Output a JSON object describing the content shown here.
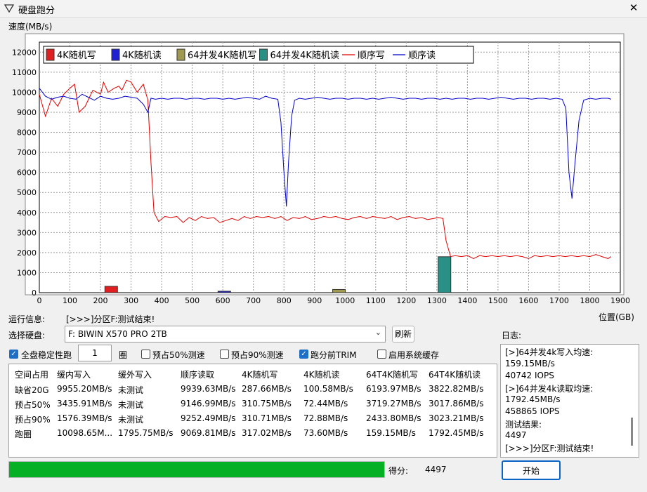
{
  "window": {
    "title": "硬盘跑分"
  },
  "chart_data": {
    "type": "line",
    "ylabel": "速度(MB/s)",
    "xlabel": "位置(GB)",
    "xlim": [
      0,
      1900
    ],
    "ylim": [
      0,
      12500
    ],
    "xticks": [
      0,
      100,
      200,
      300,
      400,
      500,
      600,
      700,
      800,
      900,
      1000,
      1100,
      1200,
      1300,
      1400,
      1500,
      1600,
      1700,
      1800,
      1900
    ],
    "yticks": [
      0,
      1000,
      2000,
      3000,
      4000,
      5000,
      6000,
      7000,
      8000,
      9000,
      10000,
      11000,
      12000
    ],
    "legend": [
      {
        "label": "4K随机写",
        "kind": "bar",
        "color": "#e02020"
      },
      {
        "label": "4K随机读",
        "kind": "bar",
        "color": "#2020d0"
      },
      {
        "label": "64并发4K随机写",
        "kind": "bar",
        "color": "#a09a50"
      },
      {
        "label": "64并发4K随机读",
        "kind": "bar",
        "color": "#2a8f85"
      },
      {
        "label": "顺序写",
        "kind": "line",
        "color": "#e00000"
      },
      {
        "label": "顺序读",
        "kind": "line",
        "color": "#0000cc"
      }
    ],
    "bars": [
      {
        "series": "4K随机写",
        "x": 235,
        "value": 317.02,
        "color": "#e02020"
      },
      {
        "series": "4K随机读",
        "x": 605,
        "value": 73.6,
        "color": "#2020d0"
      },
      {
        "series": "64并发4K随机写",
        "x": 980,
        "value": 159.15,
        "color": "#a09a50"
      },
      {
        "series": "64并发4K随机读",
        "x": 1325,
        "value": 1792.45,
        "color": "#2a8f85"
      }
    ],
    "series": [
      {
        "name": "顺序写",
        "color": "#e00000",
        "points": [
          [
            0,
            9900
          ],
          [
            20,
            8800
          ],
          [
            40,
            9700
          ],
          [
            60,
            9300
          ],
          [
            80,
            9900
          ],
          [
            100,
            10200
          ],
          [
            115,
            10400
          ],
          [
            130,
            9000
          ],
          [
            150,
            9300
          ],
          [
            175,
            10100
          ],
          [
            200,
            9900
          ],
          [
            210,
            10500
          ],
          [
            225,
            10000
          ],
          [
            245,
            10200
          ],
          [
            260,
            10300
          ],
          [
            270,
            10100
          ],
          [
            285,
            10600
          ],
          [
            300,
            10500
          ],
          [
            320,
            10000
          ],
          [
            340,
            10400
          ],
          [
            355,
            9600
          ],
          [
            365,
            6500
          ],
          [
            375,
            4000
          ],
          [
            390,
            3550
          ],
          [
            410,
            3800
          ],
          [
            430,
            3750
          ],
          [
            450,
            3800
          ],
          [
            470,
            3500
          ],
          [
            490,
            3750
          ],
          [
            510,
            3600
          ],
          [
            530,
            3800
          ],
          [
            550,
            3700
          ],
          [
            570,
            3750
          ],
          [
            590,
            3500
          ],
          [
            610,
            3600
          ],
          [
            630,
            3700
          ],
          [
            650,
            3600
          ],
          [
            670,
            3800
          ],
          [
            690,
            3700
          ],
          [
            710,
            3800
          ],
          [
            730,
            3750
          ],
          [
            750,
            3800
          ],
          [
            770,
            3700
          ],
          [
            790,
            3800
          ],
          [
            810,
            3600
          ],
          [
            830,
            3750
          ],
          [
            850,
            3700
          ],
          [
            870,
            3800
          ],
          [
            890,
            3650
          ],
          [
            910,
            3700
          ],
          [
            930,
            3800
          ],
          [
            950,
            3750
          ],
          [
            970,
            3800
          ],
          [
            990,
            3700
          ],
          [
            1010,
            3650
          ],
          [
            1030,
            3750
          ],
          [
            1050,
            3800
          ],
          [
            1070,
            3700
          ],
          [
            1090,
            3800
          ],
          [
            1110,
            3750
          ],
          [
            1130,
            3700
          ],
          [
            1150,
            3800
          ],
          [
            1170,
            3650
          ],
          [
            1190,
            3750
          ],
          [
            1210,
            3800
          ],
          [
            1230,
            3700
          ],
          [
            1250,
            3750
          ],
          [
            1270,
            3650
          ],
          [
            1290,
            3700
          ],
          [
            1305,
            3750
          ],
          [
            1320,
            3700
          ],
          [
            1330,
            2600
          ],
          [
            1345,
            1800
          ],
          [
            1360,
            1850
          ],
          [
            1380,
            1800
          ],
          [
            1400,
            1850
          ],
          [
            1420,
            1700
          ],
          [
            1440,
            1850
          ],
          [
            1460,
            1800
          ],
          [
            1480,
            1850
          ],
          [
            1500,
            1800
          ],
          [
            1520,
            1850
          ],
          [
            1540,
            1800
          ],
          [
            1560,
            1850
          ],
          [
            1580,
            1800
          ],
          [
            1600,
            1700
          ],
          [
            1620,
            1850
          ],
          [
            1640,
            1800
          ],
          [
            1660,
            1850
          ],
          [
            1680,
            1800
          ],
          [
            1700,
            1850
          ],
          [
            1720,
            1800
          ],
          [
            1740,
            1850
          ],
          [
            1760,
            1800
          ],
          [
            1780,
            1850
          ],
          [
            1800,
            1800
          ],
          [
            1820,
            1900
          ],
          [
            1840,
            1800
          ],
          [
            1860,
            1700
          ],
          [
            1870,
            1800
          ]
        ]
      },
      {
        "name": "顺序读",
        "color": "#0000cc",
        "points": [
          [
            0,
            10200
          ],
          [
            20,
            9800
          ],
          [
            40,
            9650
          ],
          [
            60,
            9750
          ],
          [
            80,
            9800
          ],
          [
            100,
            9700
          ],
          [
            120,
            9650
          ],
          [
            140,
            9900
          ],
          [
            160,
            9750
          ],
          [
            180,
            9600
          ],
          [
            200,
            9800
          ],
          [
            220,
            9700
          ],
          [
            240,
            9650
          ],
          [
            260,
            9700
          ],
          [
            280,
            9800
          ],
          [
            300,
            9750
          ],
          [
            320,
            9700
          ],
          [
            340,
            9400
          ],
          [
            355,
            9000
          ],
          [
            365,
            9700
          ],
          [
            380,
            9650
          ],
          [
            400,
            9700
          ],
          [
            420,
            9650
          ],
          [
            440,
            9700
          ],
          [
            460,
            9700
          ],
          [
            480,
            9650
          ],
          [
            500,
            9700
          ],
          [
            520,
            9700
          ],
          [
            540,
            9650
          ],
          [
            560,
            9700
          ],
          [
            580,
            9700
          ],
          [
            600,
            9650
          ],
          [
            620,
            9700
          ],
          [
            640,
            9650
          ],
          [
            660,
            9700
          ],
          [
            680,
            9750
          ],
          [
            700,
            9700
          ],
          [
            720,
            9650
          ],
          [
            740,
            9800
          ],
          [
            760,
            9700
          ],
          [
            780,
            9650
          ],
          [
            790,
            8500
          ],
          [
            800,
            6000
          ],
          [
            808,
            4300
          ],
          [
            815,
            6500
          ],
          [
            825,
            8800
          ],
          [
            835,
            9600
          ],
          [
            850,
            9700
          ],
          [
            870,
            9650
          ],
          [
            890,
            9700
          ],
          [
            910,
            9750
          ],
          [
            930,
            9700
          ],
          [
            950,
            9650
          ],
          [
            970,
            9700
          ],
          [
            990,
            9700
          ],
          [
            1010,
            9650
          ],
          [
            1030,
            9700
          ],
          [
            1050,
            9700
          ],
          [
            1070,
            9650
          ],
          [
            1090,
            9700
          ],
          [
            1110,
            9650
          ],
          [
            1130,
            9700
          ],
          [
            1150,
            9750
          ],
          [
            1170,
            9700
          ],
          [
            1190,
            9650
          ],
          [
            1210,
            9700
          ],
          [
            1230,
            9700
          ],
          [
            1250,
            9650
          ],
          [
            1270,
            9700
          ],
          [
            1290,
            9700
          ],
          [
            1310,
            9650
          ],
          [
            1330,
            9700
          ],
          [
            1350,
            9650
          ],
          [
            1370,
            9700
          ],
          [
            1390,
            9700
          ],
          [
            1410,
            9650
          ],
          [
            1430,
            9700
          ],
          [
            1450,
            9700
          ],
          [
            1470,
            9650
          ],
          [
            1490,
            9700
          ],
          [
            1510,
            9750
          ],
          [
            1530,
            9700
          ],
          [
            1550,
            9650
          ],
          [
            1570,
            9700
          ],
          [
            1590,
            9700
          ],
          [
            1610,
            9650
          ],
          [
            1630,
            9700
          ],
          [
            1650,
            9700
          ],
          [
            1670,
            9650
          ],
          [
            1690,
            9700
          ],
          [
            1710,
            9650
          ],
          [
            1722,
            9200
          ],
          [
            1732,
            6000
          ],
          [
            1742,
            4700
          ],
          [
            1752,
            6500
          ],
          [
            1765,
            8600
          ],
          [
            1780,
            9600
          ],
          [
            1800,
            9700
          ],
          [
            1820,
            9650
          ],
          [
            1840,
            9700
          ],
          [
            1860,
            9700
          ],
          [
            1870,
            9650
          ]
        ]
      }
    ]
  },
  "run_info": {
    "label": "运行信息:",
    "value": "[>>>]分区F:测试结束!"
  },
  "disk": {
    "label": "选择硬盘:",
    "value": "F: BIWIN X570 PRO 2TB",
    "refresh": "刷新"
  },
  "log": {
    "label": "日志:",
    "lines": [
      "[>]64并发4k写入均速:",
      "159.15MB/s",
      "40742 IOPS",
      "[>]64并发4k读取均速:",
      "1792.45MB/s",
      "458865 IOPS",
      "测试结果:",
      "4497",
      "[>>>]分区F:测试结束!"
    ]
  },
  "options": {
    "full_disk": {
      "label": "全盘稳定性跑",
      "checked": true
    },
    "laps_value": "1",
    "laps_unit": "圈",
    "prefill50": {
      "label": "预占50%测速",
      "checked": false
    },
    "prefill90": {
      "label": "预占90%测速",
      "checked": false
    },
    "trim": {
      "label": "跑分前TRIM",
      "checked": true
    },
    "syscache": {
      "label": "启用系统缓存",
      "checked": false
    }
  },
  "table": {
    "headers": [
      "空间占用",
      "缓内写入",
      "缓外写入",
      "顺序读取",
      "4K随机写",
      "4K随机读",
      "64T4K随机写",
      "64T4K随机读"
    ],
    "rows": [
      [
        "缺省20G",
        "9955.20MB/s",
        "未测试",
        "9939.63MB/s",
        "287.66MB/s",
        "100.58MB/s",
        "6193.97MB/s",
        "3822.82MB/s"
      ],
      [
        "预占50%",
        "3435.91MB/s",
        "未测试",
        "9146.99MB/s",
        "310.75MB/s",
        "72.44MB/s",
        "3719.27MB/s",
        "3017.86MB/s"
      ],
      [
        "预占90%",
        "1576.39MB/s",
        "未测试",
        "9252.49MB/s",
        "310.71MB/s",
        "72.88MB/s",
        "2433.80MB/s",
        "3023.21MB/s"
      ],
      [
        "跑圈",
        "10098.65M...",
        "1795.75MB/s",
        "9069.81MB/s",
        "317.02MB/s",
        "73.60MB/s",
        "159.15MB/s",
        "1792.45MB/s"
      ]
    ]
  },
  "progress": {
    "fraction": 1.0,
    "color": "#06b025"
  },
  "score": {
    "label": "得分:",
    "value": "4497"
  },
  "start_button": "开始",
  "close_glyph": "✕"
}
